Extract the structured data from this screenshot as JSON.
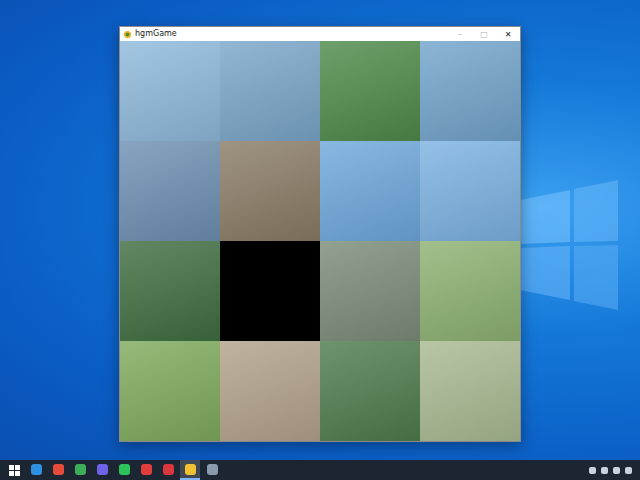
{
  "window": {
    "title": "hgmGame",
    "controls": [
      {
        "label": "–",
        "disabled": true
      },
      {
        "label": "□",
        "disabled": true
      },
      {
        "label": "✕",
        "disabled": false
      }
    ]
  },
  "puzzle": {
    "tiles": [
      {
        "empty": false,
        "color": "#8fbadb"
      },
      {
        "empty": false,
        "color": "#7aa6c9"
      },
      {
        "empty": false,
        "color": "#4f8a4a"
      },
      {
        "empty": false,
        "color": "#72a4cc"
      },
      {
        "empty": false,
        "color": "#6d90b2"
      },
      {
        "empty": false,
        "color": "#8a7c66"
      },
      {
        "empty": false,
        "color": "#6ea8dc"
      },
      {
        "empty": false,
        "color": "#7cb2e2"
      },
      {
        "empty": false,
        "color": "#3f6e40"
      },
      {
        "empty": true,
        "color": "#000000"
      },
      {
        "empty": false,
        "color": "#7b8c7a"
      },
      {
        "empty": false,
        "color": "#8db272"
      },
      {
        "empty": false,
        "color": "#7fab5c"
      },
      {
        "empty": false,
        "color": "#b3a38a"
      },
      {
        "empty": false,
        "color": "#4e7c4c"
      },
      {
        "empty": false,
        "color": "#a9ba92"
      }
    ]
  },
  "taskbar": {
    "apps": [
      {
        "color": "#2f8fe0",
        "selected": false
      },
      {
        "color": "#e64a3b",
        "selected": false
      },
      {
        "color": "#3cae5a",
        "selected": false
      },
      {
        "color": "#6c63e8",
        "selected": false
      },
      {
        "color": "#2dc35a",
        "selected": false
      },
      {
        "color": "#e23d3d",
        "selected": false
      },
      {
        "color": "#d9363e",
        "selected": false
      },
      {
        "color": "#f2c233",
        "selected": true
      },
      {
        "color": "#8a9bb0",
        "selected": false
      }
    ]
  }
}
